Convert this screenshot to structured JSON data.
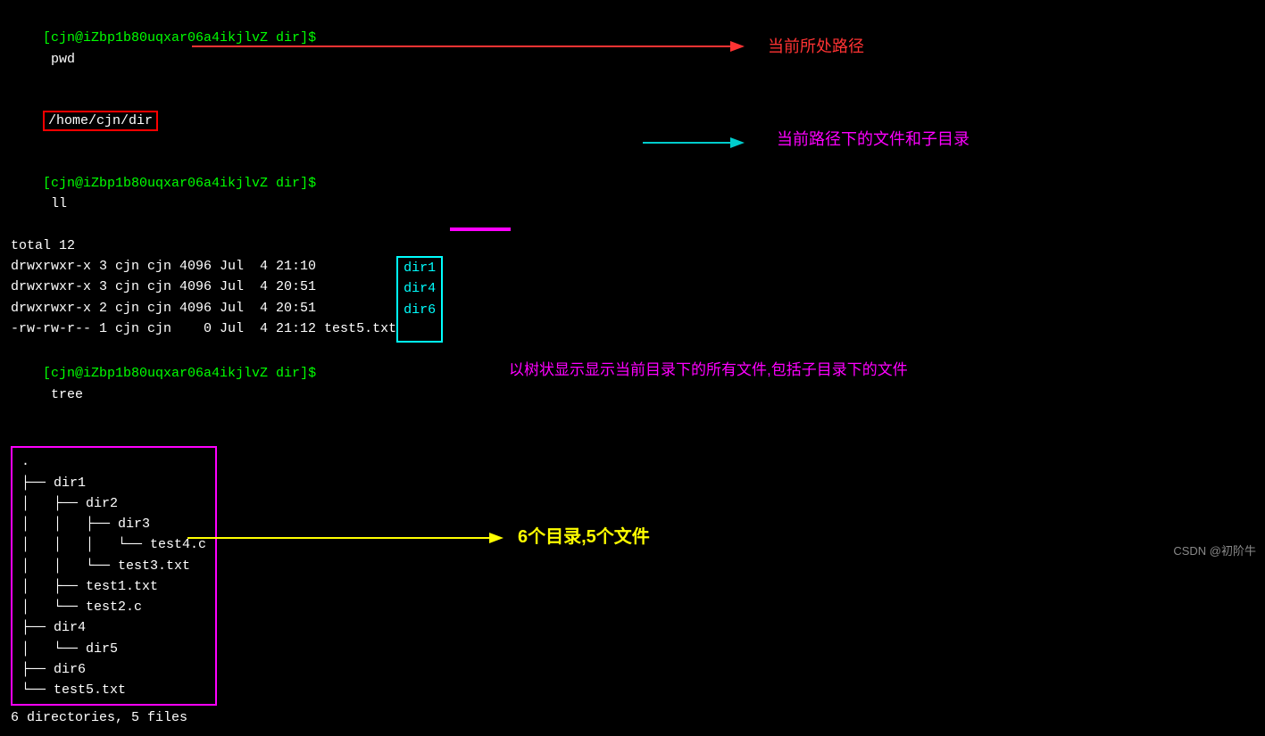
{
  "terminal": {
    "lines": [
      {
        "id": "pwd-prompt",
        "text": "[cjn@iZbp1b80uqxar06a4ikjlvZ dir]$ pwd"
      },
      {
        "id": "pwd-result",
        "text": "/home/cjn/dir",
        "highlight": "red-box"
      },
      {
        "id": "ll-prompt",
        "text": "[cjn@iZbp1b80uqxar06a4ikjlvZ dir]$ ll"
      },
      {
        "id": "ll-total",
        "text": "total 12"
      },
      {
        "id": "ll-dir1",
        "text": "drwxrwxr-x 3 cjn cjn 4096 Jul  4 21:10 ",
        "highlight_item": "dir1"
      },
      {
        "id": "ll-dir4",
        "text": "drwxrwxr-x 3 cjn cjn 4096 Jul  4 20:51 ",
        "highlight_item": "dir4"
      },
      {
        "id": "ll-dir6",
        "text": "drwxrwxr-x 2 cjn cjn 4096 Jul  4 20:51 ",
        "highlight_item": "dir6"
      },
      {
        "id": "ll-test5",
        "text": "-rw-rw-r-- 1 cjn cjn    0 Jul  4 21:12 test5.txt"
      },
      {
        "id": "tree-prompt",
        "text": "[cjn@iZbp1b80uqxar06a4ikjlvZ dir]$ tree"
      },
      {
        "id": "tree-dot",
        "text": "."
      },
      {
        "id": "tree-dir1",
        "text": "├── dir1"
      },
      {
        "id": "tree-dir2",
        "text": "│   ├── dir2"
      },
      {
        "id": "tree-dir3",
        "text": "│   │   ├── dir3"
      },
      {
        "id": "tree-test4",
        "text": "│   │   │   └── test4.c"
      },
      {
        "id": "tree-test3",
        "text": "│   │   └── test3.txt"
      },
      {
        "id": "tree-test1",
        "text": "│   ├── test1.txt"
      },
      {
        "id": "tree-test2",
        "text": "│   └── test2.c"
      },
      {
        "id": "tree-dir4",
        "text": "├── dir4"
      },
      {
        "id": "tree-dir5",
        "text": "│   └── dir5"
      },
      {
        "id": "tree-dir6",
        "text": "├── dir6"
      },
      {
        "id": "tree-test5",
        "text": "└── test5.txt"
      },
      {
        "id": "tree-summary",
        "text": "6 directories, 5 files"
      }
    ],
    "annotations": [
      {
        "id": "ann-path",
        "text": "当前所处路径",
        "color": "#ff3333"
      },
      {
        "id": "ann-files",
        "text": "当前路径下的文件和子目录",
        "color": "#ff00ff"
      },
      {
        "id": "ann-tree",
        "text": "以树状显示显示当前目录下的所有文件,包括子目录下的文件",
        "color": "#ff00ff"
      },
      {
        "id": "ann-count",
        "text": "6个目录,5个文件",
        "color": "#ffff00"
      }
    ],
    "csdn_label": "CSDN @初阶牛"
  }
}
